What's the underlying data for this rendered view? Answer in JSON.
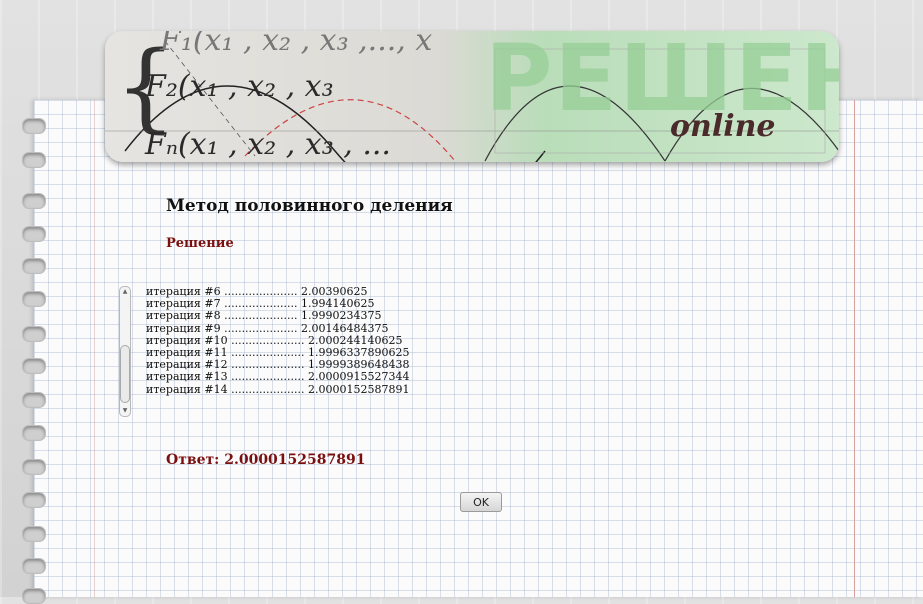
{
  "banner": {
    "logo_word": "РЕШЕНИЕ",
    "logo_sub": "online",
    "formula_lines": [
      "F₁(x₁ , x₂ , x₃ ,..., x",
      "F₂(x₁ , x₂ , x₃",
      "Fₙ(x₁ , x₂ , x₃ , ..."
    ]
  },
  "page": {
    "title": "Метод половинного деления",
    "section": "Решение"
  },
  "iterations": [
    "итерация #6 ..................... 2.00390625",
    "итерация #7 ..................... 1.994140625",
    "итерация #8 ..................... 1.9990234375",
    "итерация #9 ..................... 2.00146484375",
    "итерация #10 ..................... 2.000244140625",
    "итерация #11 ..................... 1.9996337890625",
    "итерация #12 ..................... 1.9999389648438",
    "итерация #13 ..................... 2.0000915527344",
    "итерация #14 ..................... 2.0000152587891"
  ],
  "answer": "Ответ: 2.0000152587891",
  "ok_label": "OK",
  "colors": {
    "accent": "#7a0f0f",
    "logo_green": "#96cd96"
  }
}
